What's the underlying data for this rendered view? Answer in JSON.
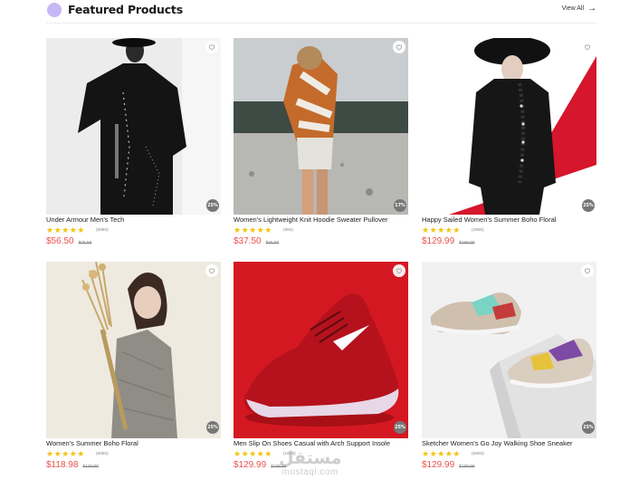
{
  "header": {
    "title": "Featured Products",
    "view_all": "View All",
    "arrow_icon": "→"
  },
  "heart_icon": "heart-icon",
  "stars": "★★★★★",
  "products": [
    {
      "name": "Under Armour Men's Tech",
      "reviews": "(5955)",
      "price": "$56.50",
      "old_price": "$75.58",
      "discount": "25%"
    },
    {
      "name": "Women's Lightweight Knit Hoodie Sweater Pullover",
      "reviews": "(994)",
      "price": "$37.50",
      "old_price": "$45.55",
      "discount": "17%"
    },
    {
      "name": "Happy Sailed Women's Summer Boho Floral",
      "reviews": "(2985)",
      "price": "$129.99",
      "old_price": "$189.99",
      "discount": "25%"
    },
    {
      "name": "Women's Summer Boho Floral",
      "reviews": "(5955)",
      "price": "$118.98",
      "old_price": "$149.99",
      "discount": "25%"
    },
    {
      "name": "Men Slip On Shoes Casual with Arch Support Insole",
      "reviews": "(1958)",
      "price": "$129.99",
      "old_price": "$169.99",
      "discount": "25%"
    },
    {
      "name": "Sketcher Women's Go Joy Walking Shoe Sneaker",
      "reviews": "(5955)",
      "price": "$129.99",
      "old_price": "$189.99",
      "discount": "25%"
    }
  ],
  "watermark": {
    "arabic": "مستقل",
    "latin": "mostaql.com"
  }
}
